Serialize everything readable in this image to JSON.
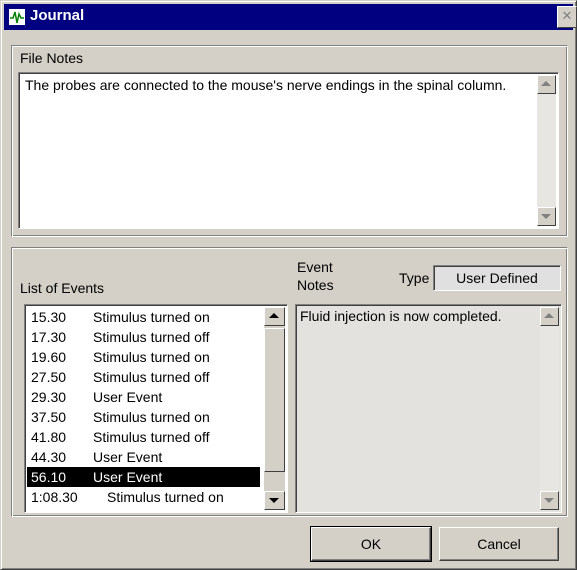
{
  "window": {
    "title": "Journal",
    "close_glyph": "✕"
  },
  "file_notes": {
    "label": "File Notes",
    "text": "The probes are connected to the mouse's nerve endings in the spinal column."
  },
  "events": {
    "list_label": "List of Events",
    "items": [
      {
        "time": "15.30",
        "desc": "Stimulus turned on"
      },
      {
        "time": "17.30",
        "desc": "Stimulus turned off"
      },
      {
        "time": "19.60",
        "desc": "Stimulus turned on"
      },
      {
        "time": "27.50",
        "desc": "Stimulus turned off"
      },
      {
        "time": "29.30",
        "desc": "User Event"
      },
      {
        "time": "37.50",
        "desc": "Stimulus turned on"
      },
      {
        "time": "41.80",
        "desc": "Stimulus turned off"
      },
      {
        "time": "44.30",
        "desc": "User Event"
      },
      {
        "time": "56.10",
        "desc": "User Event"
      },
      {
        "time": "1:08.30",
        "desc": "Stimulus turned on"
      }
    ],
    "selected_index": 8,
    "notes_label_line1": "Event",
    "notes_label_line2": "Notes",
    "type_label": "Type",
    "type_value": "User Defined",
    "notes_text": "Fluid injection is now completed."
  },
  "buttons": {
    "ok": "OK",
    "cancel": "Cancel"
  },
  "colors": {
    "face": "#d4d0c8",
    "titlebar": "#000080",
    "selection": "#000000"
  },
  "icons": {
    "app": "waveform-icon",
    "scroll_up": "arrow-up-icon",
    "scroll_down": "arrow-down-icon"
  }
}
